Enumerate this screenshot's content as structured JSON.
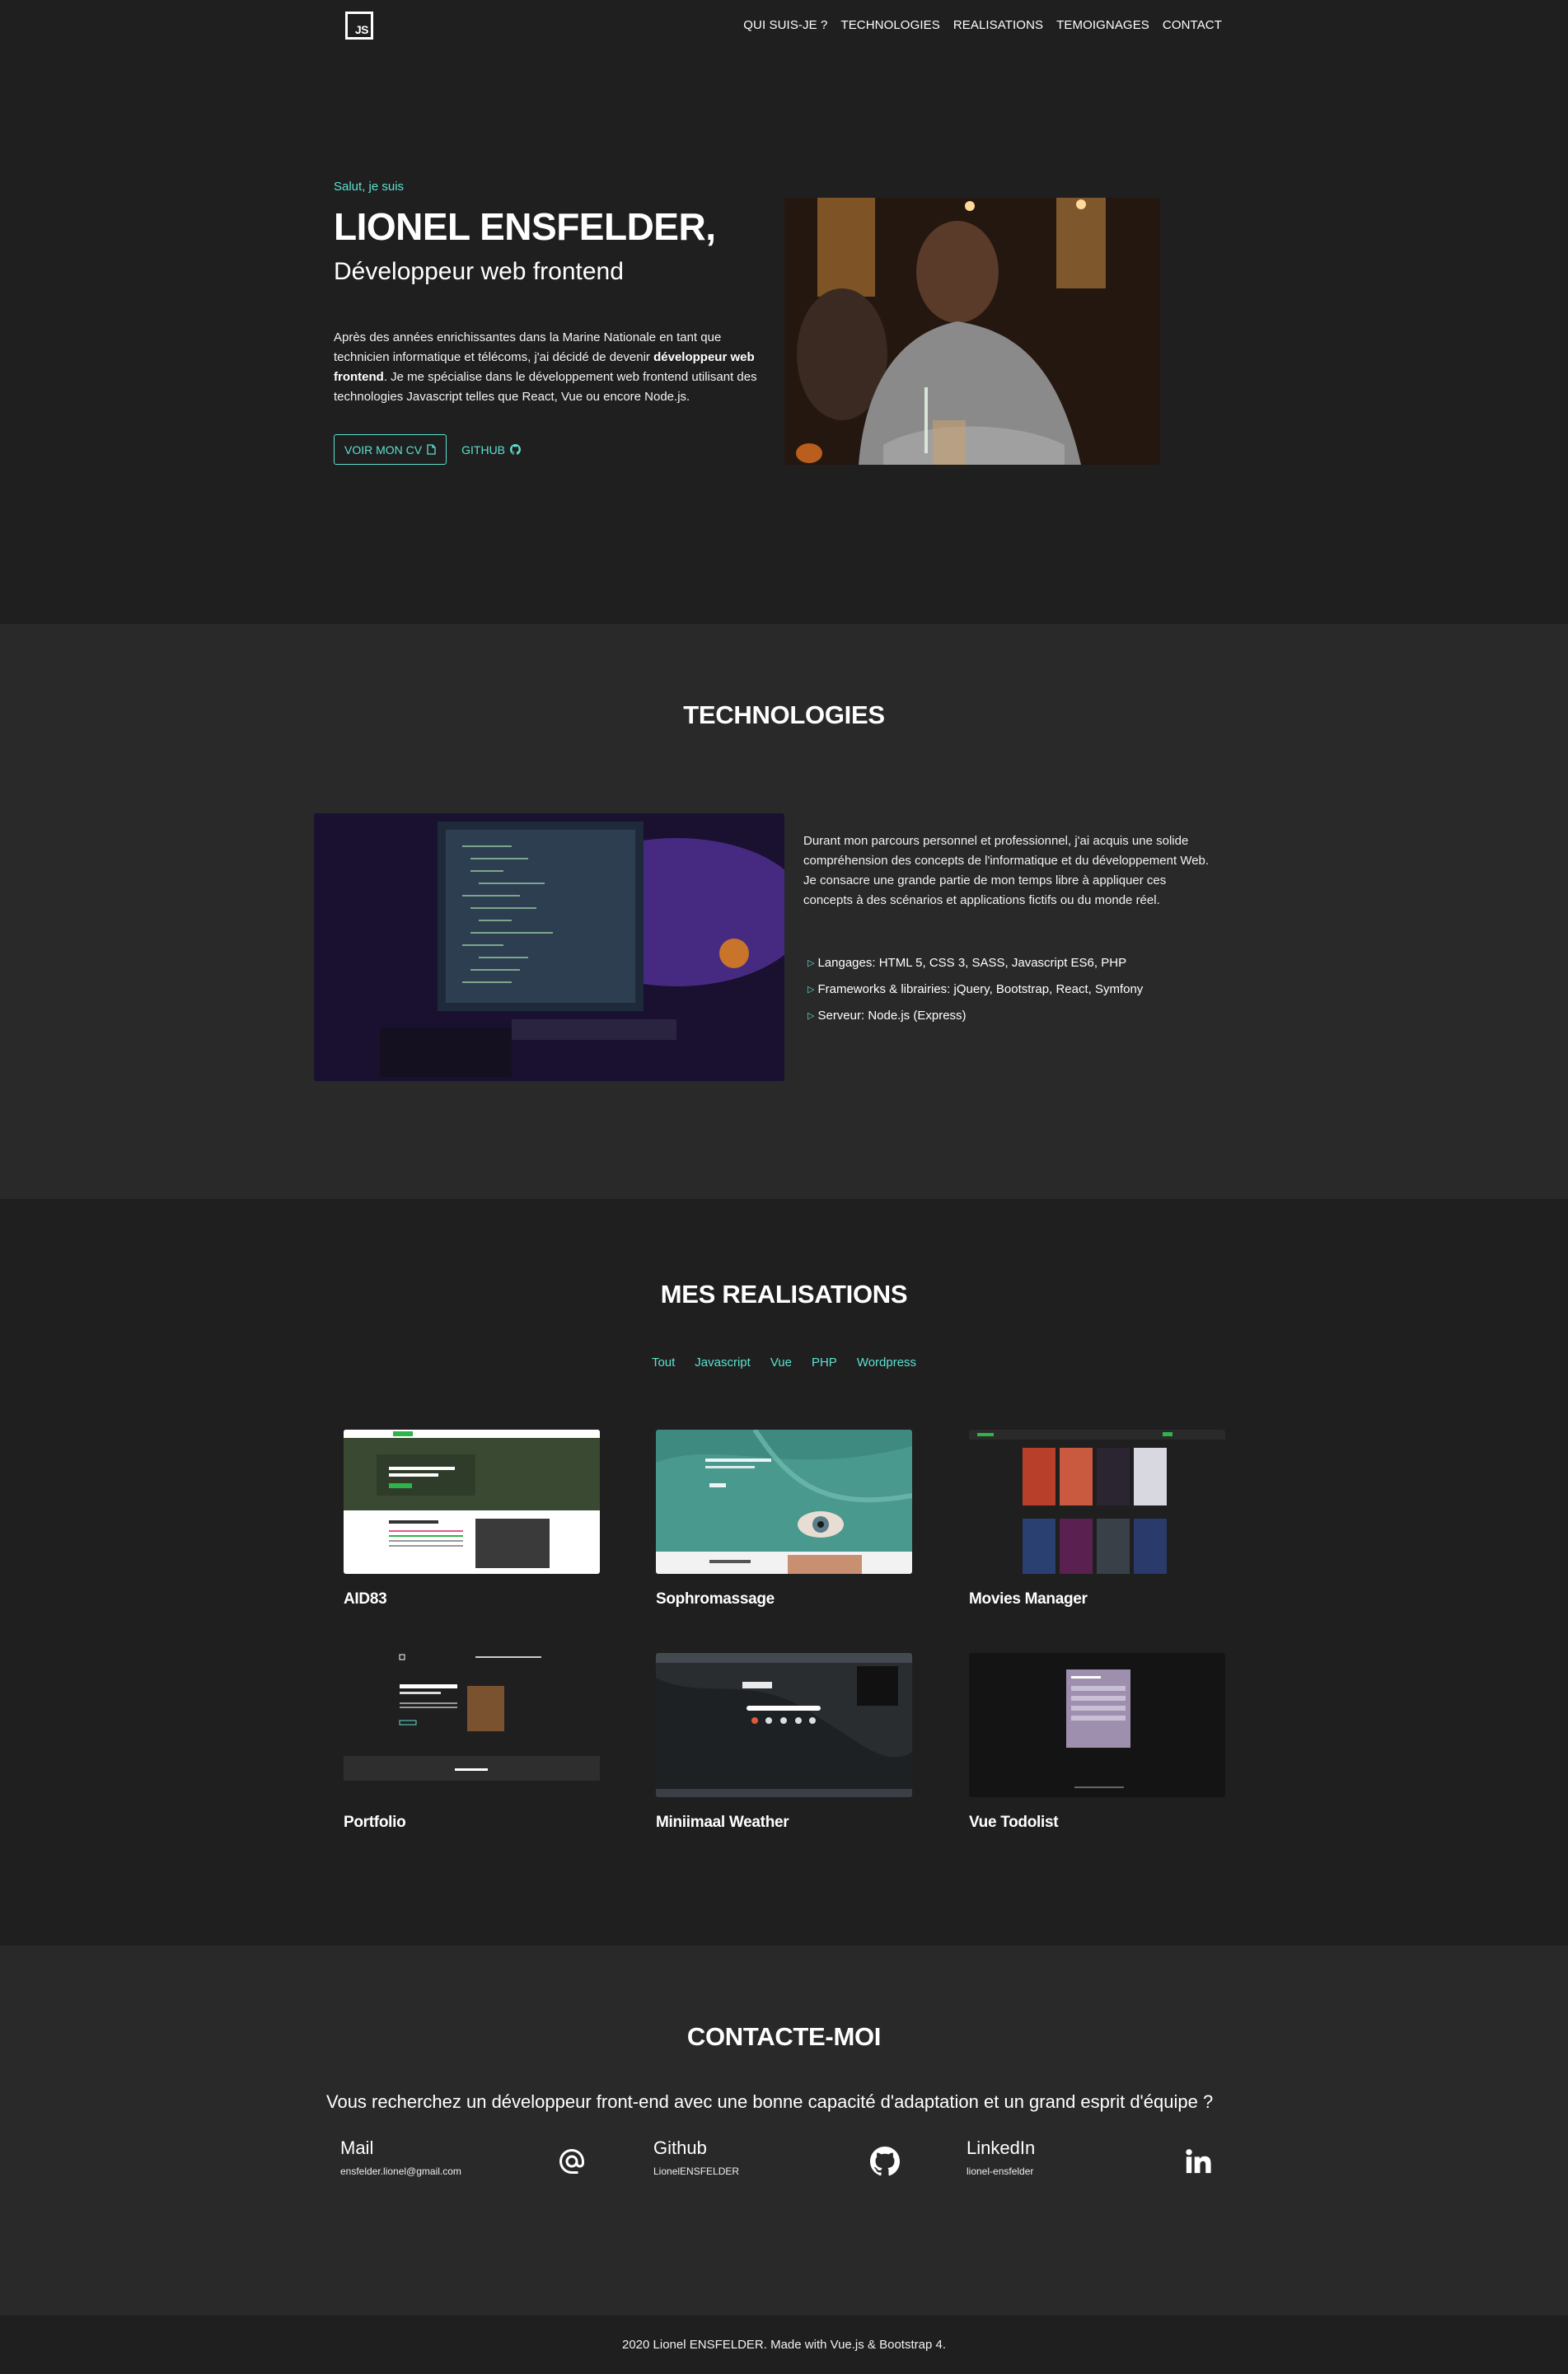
{
  "nav": {
    "logo": "JS",
    "items": [
      "QUI SUIS-JE ?",
      "TECHNOLOGIES",
      "REALISATIONS",
      "TEMOIGNAGES",
      "CONTACT"
    ]
  },
  "hero": {
    "greeting": "Salut, je suis",
    "name": "LIONEL ENSFELDER,",
    "role": "Développeur web frontend",
    "bio_before": "Après des années enrichissantes dans la Marine Nationale en tant que technicien informatique et télécoms, j'ai décidé de devenir ",
    "bio_bold": "développeur web frontend",
    "bio_after": ". Je me spécialise dans le développement web frontend utilisant des technologies Javascript telles que React, Vue ou encore Node.js.",
    "cv_button": "VOIR MON CV",
    "github_link": "GITHUB"
  },
  "technologies": {
    "title": "TECHNOLOGIES",
    "description": "Durant mon parcours personnel et professionnel, j'ai acquis une solide compréhension des concepts de l'informatique et du développement Web. Je consacre une grande partie de mon temps libre à appliquer ces concepts à des scénarios et applications fictifs ou du monde réel.",
    "items": [
      "Langages: HTML 5, CSS 3, SASS, Javascript ES6, PHP",
      "Frameworks & librairies: jQuery, Bootstrap, React, Symfony",
      "Serveur: Node.js (Express)"
    ]
  },
  "realisations": {
    "title": "MES REALISATIONS",
    "filters": [
      "Tout",
      "Javascript",
      "Vue",
      "PHP",
      "Wordpress"
    ],
    "projects": [
      {
        "name": "AID83"
      },
      {
        "name": "Sophromassage"
      },
      {
        "name": "Movies Manager"
      },
      {
        "name": "Portfolio"
      },
      {
        "name": "Miniimaal Weather"
      },
      {
        "name": "Vue Todolist"
      }
    ]
  },
  "contact": {
    "title": "CONTACTE-MOI",
    "question": "Vous recherchez un développeur front-end avec une bonne capacité d'adaptation et un grand esprit d'équipe ?",
    "cards": [
      {
        "name": "Mail",
        "value": "ensfelder.lionel@gmail.com",
        "icon": "at-icon"
      },
      {
        "name": "Github",
        "value": "LionelENSFELDER",
        "icon": "github-icon"
      },
      {
        "name": "LinkedIn",
        "value": "lionel-ensfelder",
        "icon": "linkedin-icon"
      }
    ]
  },
  "footer": {
    "text": "2020 Lionel ENSFELDER. Made with Vue.js & Bootstrap 4."
  },
  "colors": {
    "accent": "#5ce1d0",
    "bg_dark": "#1f1f1f",
    "bg_section": "#292929"
  }
}
